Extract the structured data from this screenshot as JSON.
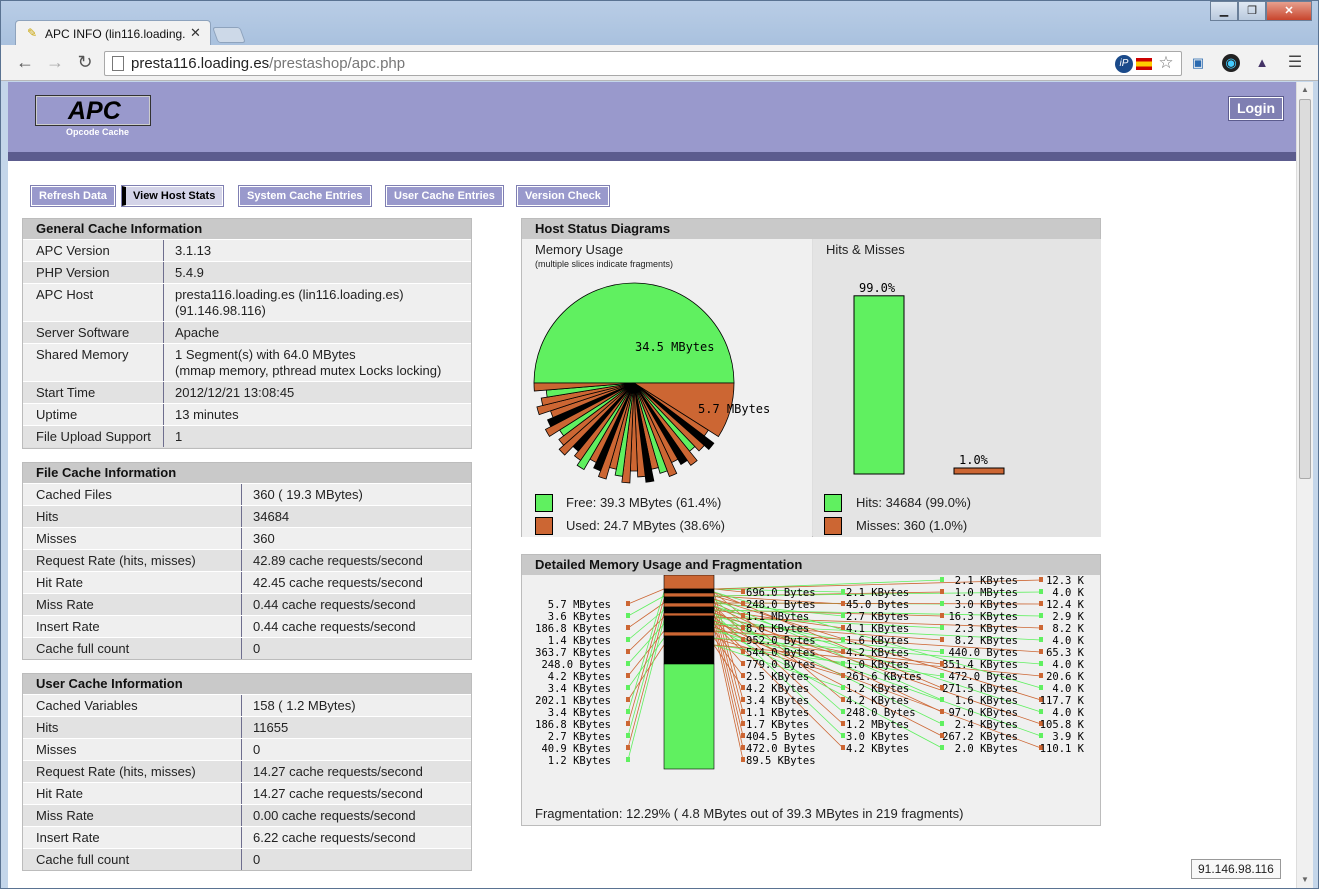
{
  "browser": {
    "tab_title": "APC INFO (lin116.loading.",
    "url_host": "presta116.loading.es",
    "url_path": "/prestashop/apc.php",
    "window_buttons": [
      "▁",
      "❐",
      "✕"
    ]
  },
  "header": {
    "logo": "APC",
    "logo_sub": "Opcode Cache",
    "login": "Login"
  },
  "menu": [
    "Refresh Data",
    "View Host Stats",
    "System Cache Entries",
    "User Cache Entries",
    "Version Check"
  ],
  "general": {
    "title": "General Cache Information",
    "rows": [
      {
        "k": "APC Version",
        "v": "3.1.13"
      },
      {
        "k": "PHP Version",
        "v": "5.4.9"
      },
      {
        "k": "APC Host",
        "v": "presta116.loading.es (lin116.loading.es)",
        "v2": "(91.146.98.116)"
      },
      {
        "k": "Server Software",
        "v": "Apache"
      },
      {
        "k": "Shared Memory",
        "v": "1 Segment(s) with 64.0 MBytes",
        "v2": "(mmap memory, pthread mutex Locks locking)"
      },
      {
        "k": "Start Time",
        "v": "2012/12/21 13:08:45"
      },
      {
        "k": "Uptime",
        "v": "13 minutes"
      },
      {
        "k": "File Upload Support",
        "v": "1"
      }
    ]
  },
  "file_cache": {
    "title": "File Cache Information",
    "rows": [
      {
        "k": "Cached Files",
        "v": "360 ( 19.3 MBytes)"
      },
      {
        "k": "Hits",
        "v": "34684"
      },
      {
        "k": "Misses",
        "v": "360"
      },
      {
        "k": "Request Rate (hits, misses)",
        "v": "42.89 cache requests/second"
      },
      {
        "k": "Hit Rate",
        "v": "42.45 cache requests/second"
      },
      {
        "k": "Miss Rate",
        "v": "0.44 cache requests/second"
      },
      {
        "k": "Insert Rate",
        "v": "0.44 cache requests/second"
      },
      {
        "k": "Cache full count",
        "v": "0"
      }
    ]
  },
  "user_cache": {
    "title": "User Cache Information",
    "rows": [
      {
        "k": "Cached Variables",
        "v": "158 ( 1.2 MBytes)"
      },
      {
        "k": "Hits",
        "v": "11655"
      },
      {
        "k": "Misses",
        "v": "0"
      },
      {
        "k": "Request Rate (hits, misses)",
        "v": "14.27 cache requests/second"
      },
      {
        "k": "Hit Rate",
        "v": "14.27 cache requests/second"
      },
      {
        "k": "Miss Rate",
        "v": "0.00 cache requests/second"
      },
      {
        "k": "Insert Rate",
        "v": "6.22 cache requests/second"
      },
      {
        "k": "Cache full count",
        "v": "0"
      }
    ]
  },
  "diagrams": {
    "title": "Host Status Diagrams",
    "memory_title": "Memory Usage",
    "memory_sub": "(multiple slices indicate fragments)",
    "pie_label_free": "34.5 MBytes",
    "pie_label_used": "5.7 MBytes",
    "legend_free": "Free: 39.3 MBytes (61.4%)",
    "legend_used": "Used: 24.7 MBytes (38.6%)",
    "hits_title": "Hits & Misses",
    "hits_pct_label": "99.0%",
    "misses_pct_label": "1.0%",
    "hits_fraction": 0.99,
    "misses_fraction": 0.01,
    "legend_hits": "Hits: 34684 (99.0%)",
    "legend_misses": "Misses: 360 (1.0%)",
    "colors": {
      "free": "#60f060",
      "used": "#cc6633"
    }
  },
  "fragmentation": {
    "title": "Detailed Memory Usage and Fragmentation",
    "col1": [
      "5.7 MBytes",
      "3.6 KBytes",
      "186.8 KBytes",
      "1.4 KBytes",
      "363.7 KBytes",
      "248.0 Bytes",
      "4.2 KBytes",
      "3.4 KBytes",
      "202.1 KBytes",
      "3.4 KBytes",
      "186.8 KBytes",
      "2.7 KBytes",
      "40.9 KBytes",
      "1.2 KBytes"
    ],
    "col2": [
      "696.0 Bytes",
      "248.0 Bytes",
      "1.1 MBytes",
      "8.0 KBytes",
      "952.0 Bytes",
      "544.0 Bytes",
      "779.0 Bytes",
      "2.5 KBytes",
      "4.2 KBytes",
      "3.4 KBytes",
      "1.1 KBytes",
      "1.7 KBytes",
      "404.5 Bytes",
      "472.0 Bytes",
      "89.5 KBytes"
    ],
    "col3": [
      "2.1 KBytes",
      "45.0 Bytes",
      "2.7 KBytes",
      "4.1 KBytes",
      "1.6 KBytes",
      "4.2 KBytes",
      "1.0 KBytes",
      "261.6 KBytes",
      "1.2 KBytes",
      "4.2 KBytes",
      "248.0 Bytes",
      "1.2 MBytes",
      "3.0 KBytes",
      "4.2 KBytes"
    ],
    "col4": [
      "2.1 KBytes",
      "1.0 MBytes",
      "3.0 KBytes",
      "16.3 KBytes",
      "2.3 KBytes",
      "8.2 KBytes",
      "440.0 Bytes",
      "351.4 KBytes",
      "472.0 Bytes",
      "271.5 KBytes",
      "1.6 KBytes",
      "97.0 KBytes",
      "2.4 KBytes",
      "267.2 KBytes",
      "2.0 KBytes"
    ],
    "col5": [
      "12.3 K",
      "4.0 K",
      "12.4 K",
      "2.9 K",
      "8.2 K",
      "4.0 K",
      "65.3 K",
      "4.0 K",
      "20.6 K",
      "4.0 K",
      "117.7 K",
      "4.0 K",
      "105.8 K",
      "3.9 K",
      "110.1 K"
    ],
    "summary": "Fragmentation: 12.29% ( 4.8 MBytes out of 39.3 MBytes in 219 fragments)"
  },
  "footer_ip": "91.146.98.116"
}
